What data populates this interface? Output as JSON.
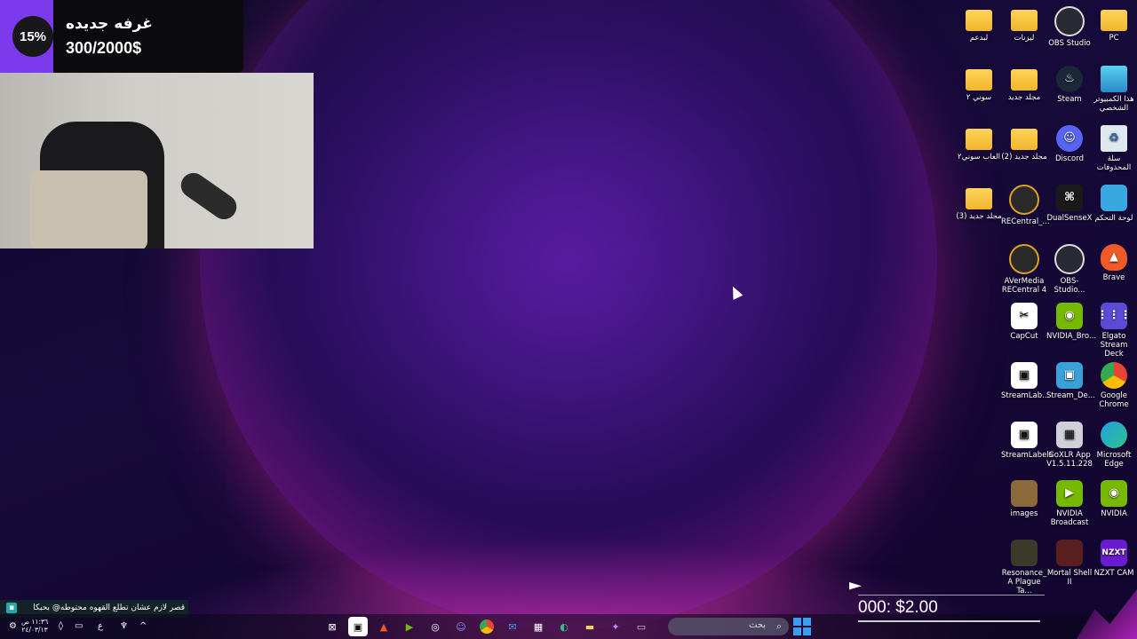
{
  "goal": {
    "percent": "15%",
    "title": "غرفه جديده",
    "progress": "300/2000$"
  },
  "desktop_icons": [
    {
      "label": "PC",
      "icon": "folder-icon"
    },
    {
      "label": "OBS Studio",
      "icon": "obs-icon"
    },
    {
      "label": "ليزنات",
      "icon": "folder-icon"
    },
    {
      "label": "لبدعم",
      "icon": "folder-icon"
    },
    {
      "label": "هذا الكمبيوتر الشخصي",
      "icon": "computer-icon"
    },
    {
      "label": "Steam",
      "icon": "steam-icon"
    },
    {
      "label": "مجلد جديد",
      "icon": "folder-icon"
    },
    {
      "label": "سوني ٢",
      "icon": "folder-icon"
    },
    {
      "label": "سلة المحذوفات",
      "icon": "recycle-bin-icon"
    },
    {
      "label": "Discord",
      "icon": "discord-icon"
    },
    {
      "label": "(2) مجلد جديد",
      "icon": "folder-icon"
    },
    {
      "label": "العاب سوني٢",
      "icon": "folder-icon"
    },
    {
      "label": "لوحة التحكم",
      "icon": "control-panel-icon"
    },
    {
      "label": "DualSenseX",
      "icon": "controller-icon"
    },
    {
      "label": "RECentral_...",
      "icon": "recentral-icon"
    },
    {
      "label": "(3) مجلد جديد",
      "icon": "folder-icon"
    },
    {
      "label": "Brave",
      "icon": "brave-icon"
    },
    {
      "label": "OBS-Studio...",
      "icon": "obs-icon"
    },
    {
      "label": "AVerMedia RECentral 4",
      "icon": "recentral-icon"
    },
    {
      "label": "Elgato Stream Deck",
      "icon": "elgato-icon"
    },
    {
      "label": "NVIDIA_Bro...",
      "icon": "nvidia-icon"
    },
    {
      "label": "CapCut",
      "icon": "capcut-icon"
    },
    {
      "label": "Google Chrome",
      "icon": "chrome-icon"
    },
    {
      "label": "Stream_De...",
      "icon": "streamdeck-icon"
    },
    {
      "label": "StreamLab...",
      "icon": "streamlabs-icon"
    },
    {
      "label": "Microsoft Edge",
      "icon": "edge-icon"
    },
    {
      "label": "GoXLR App V1.5.11.228",
      "icon": "goxlr-icon"
    },
    {
      "label": "StreamLabels",
      "icon": "streamlabs-icon"
    },
    {
      "label": "NVIDIA",
      "icon": "nvidia-icon"
    },
    {
      "label": "NVIDIA Broadcast",
      "icon": "nvidia-icon"
    },
    {
      "label": "images",
      "icon": "image-icon"
    },
    {
      "label": "NZXT CAM",
      "icon": "nzxt-icon"
    },
    {
      "label": "Mortal Shell II",
      "icon": "game-icon"
    },
    {
      "label": "Resonance_ A Plague Ta...",
      "icon": "game-icon"
    }
  ],
  "icon_glyphs": {
    "nzxt": "NZXT",
    "steam": "♨",
    "discord": "☺",
    "chrome": "",
    "capcut": "✂",
    "brave": "▲"
  },
  "chat": {
    "text": "قصر لازم عشان تطلع القهوه محتوطه@ بحبكا"
  },
  "taskbar": {
    "search_placeholder": "بحث",
    "apps": [
      {
        "name": "xbox-icon"
      },
      {
        "name": "streamlabs-icon"
      },
      {
        "name": "brave-icon"
      },
      {
        "name": "nvidia-icon"
      },
      {
        "name": "obs-icon"
      },
      {
        "name": "discord-icon",
        "badge": "1"
      },
      {
        "name": "chrome-icon"
      },
      {
        "name": "mail-icon"
      },
      {
        "name": "store-icon"
      },
      {
        "name": "edge-icon"
      },
      {
        "name": "file-explorer-icon"
      },
      {
        "name": "copilot-icon"
      },
      {
        "name": "app-icon"
      }
    ],
    "tray": {
      "time": "١١:٣٦ ص",
      "date": "٢٤/٠٣/١٣",
      "lang": "ع"
    }
  },
  "donation": {
    "text": "000: $2.00"
  }
}
